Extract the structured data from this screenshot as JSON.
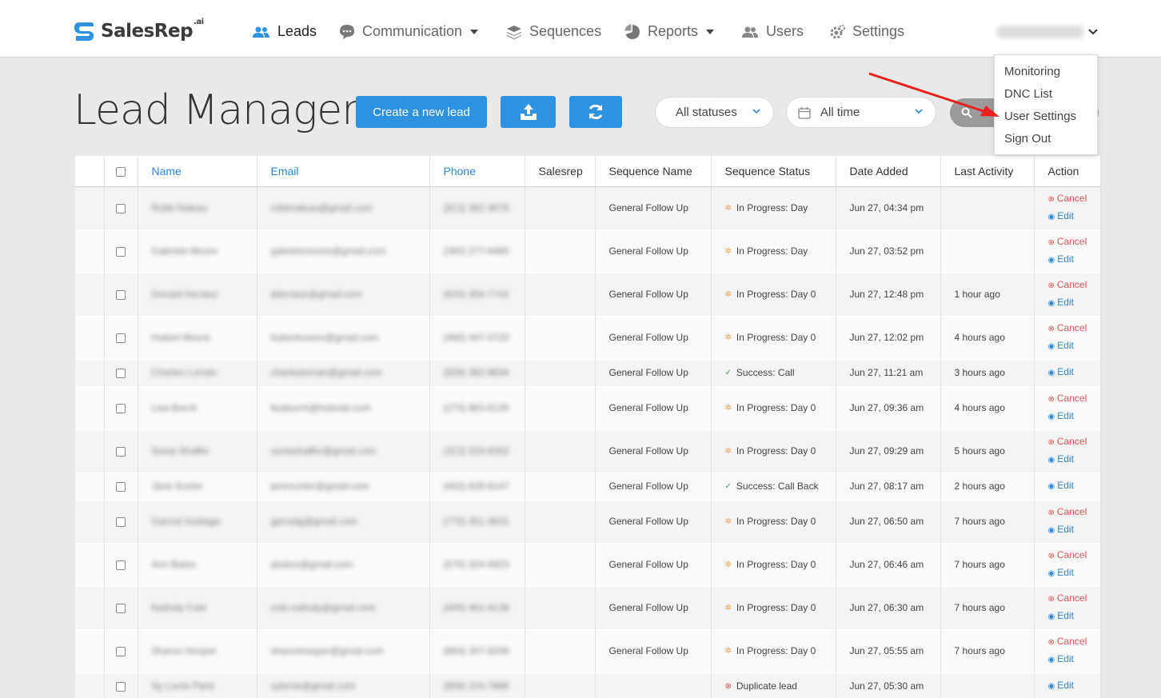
{
  "brand": {
    "name": "SalesRep",
    "sup": ".ai"
  },
  "nav": {
    "leads": "Leads",
    "communication": "Communication",
    "sequences": "Sequences",
    "reports": "Reports",
    "users": "Users",
    "settings": "Settings"
  },
  "user_menu": {
    "items": [
      "Monitoring",
      "DNC List",
      "User Settings",
      "Sign Out"
    ]
  },
  "page": {
    "title": "Lead Manager",
    "create_label": "Create a new lead",
    "status_filter": "All statuses",
    "time_filter": "All time"
  },
  "colors": {
    "accent": "#2f92e0",
    "link": "#2f86d6",
    "cancel": "#e05656",
    "success": "#3aa35a",
    "progress": "#f0a04b",
    "arrow": "#e8231f"
  },
  "table": {
    "headers": [
      "Name",
      "Email",
      "Phone",
      "Salesrep",
      "Sequence Name",
      "Sequence Status",
      "Date Added",
      "Last Activity",
      "Action"
    ],
    "cancel_label": "Cancel",
    "edit_label": "Edit",
    "rows": [
      {
        "name": "Robb Naleau",
        "email": "robbnaleau@gmail.com",
        "phone": "(813) 362-4678",
        "seq": "General Follow Up",
        "status": "In Progress: Day",
        "status_type": "progress",
        "date": "Jun 27, 04:34 pm",
        "last": "",
        "cancel": true
      },
      {
        "name": "Gabriele Moore",
        "email": "gabrielemoore@gmail.com",
        "phone": "(360) 277-6480",
        "seq": "General Follow Up",
        "status": "In Progress: Day",
        "status_type": "progress",
        "date": "Jun 27, 03:52 pm",
        "last": "",
        "cancel": true
      },
      {
        "name": "Donald Decatur",
        "email": "ddecatur@gmail.com",
        "phone": "(833) 356-7742",
        "seq": "General Follow Up",
        "status": "In Progress: Day 0",
        "status_type": "progress",
        "date": "Jun 27, 12:48 pm",
        "last": "1 hour ago",
        "cancel": true
      },
      {
        "name": "Hubert Moore",
        "email": "hubertmoore@gmail.com",
        "phone": "(480) 447-0720",
        "seq": "General Follow Up",
        "status": "In Progress: Day 0",
        "status_type": "progress",
        "date": "Jun 27, 12:02 pm",
        "last": "4 hours ago",
        "cancel": true
      },
      {
        "name": "Charles Lorrain",
        "email": "charleslorrain@gmail.com",
        "phone": "(828) 362-8834",
        "seq": "General Follow Up",
        "status": "Success: Call",
        "status_type": "success",
        "date": "Jun 27, 11:21 am",
        "last": "3 hours ago",
        "cancel": false
      },
      {
        "name": "Lisa Burch",
        "email": "lisaburch@hotmail.com",
        "phone": "(270) 883-6135",
        "seq": "General Follow Up",
        "status": "In Progress: Day 0",
        "status_type": "progress",
        "date": "Jun 27, 09:36 am",
        "last": "4 hours ago",
        "cancel": true
      },
      {
        "name": "Sonia Shaffer",
        "email": "soniashaffer@gmail.com",
        "phone": "(313) 524-8352",
        "seq": "General Follow Up",
        "status": "In Progress: Day 0",
        "status_type": "progress",
        "date": "Jun 27, 09:29 am",
        "last": "5 hours ago",
        "cancel": true
      },
      {
        "name": "Jane Sunter",
        "email": "janesunter@gmail.com",
        "phone": "(402) 839-6147",
        "seq": "General Follow Up",
        "status": "Success: Call Back",
        "status_type": "success",
        "date": "Jun 27, 08:17 am",
        "last": "2 hours ago",
        "cancel": false
      },
      {
        "name": "Garrod Guidage",
        "email": "garrodg@gmail.com",
        "phone": "(770) 451-4831",
        "seq": "General Follow Up",
        "status": "In Progress: Day 0",
        "status_type": "progress",
        "date": "Jun 27, 06:50 am",
        "last": "7 hours ago",
        "cancel": true
      },
      {
        "name": "Ann Bates",
        "email": "abates@gmail.com",
        "phone": "(570) 324-6923",
        "seq": "General Follow Up",
        "status": "In Progress: Day 0",
        "status_type": "progress",
        "date": "Jun 27, 06:46 am",
        "last": "7 hours ago",
        "cancel": true
      },
      {
        "name": "Nathaly Cole",
        "email": "cole.nathaly@gmail.com",
        "phone": "(405) 461-9138",
        "seq": "General Follow Up",
        "status": "In Progress: Day 0",
        "status_type": "progress",
        "date": "Jun 27, 06:30 am",
        "last": "7 hours ago",
        "cancel": true
      },
      {
        "name": "Sharon Hooper",
        "email": "sharonhooper@gmail.com",
        "phone": "(864) 307-8206",
        "seq": "General Follow Up",
        "status": "In Progress: Day 0",
        "status_type": "progress",
        "date": "Jun 27, 05:55 am",
        "last": "7 hours ago",
        "cancel": true
      },
      {
        "name": "Sy Lorrie Paris",
        "email": "sylorrie@gmail.com",
        "phone": "(859) 224-7866",
        "seq": "",
        "status": "Duplicate lead",
        "status_type": "duplicate",
        "date": "Jun 27, 05:30 am",
        "last": "",
        "cancel": false
      }
    ]
  }
}
